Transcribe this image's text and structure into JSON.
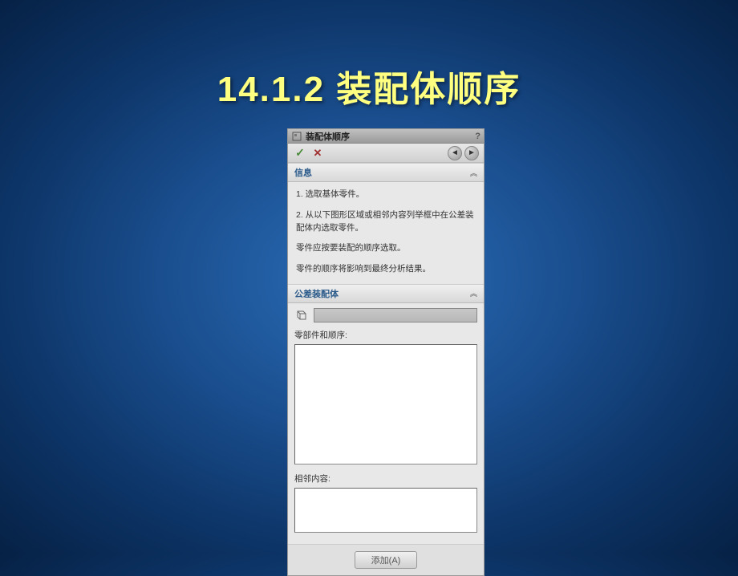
{
  "slide": {
    "title": "14.1.2  装配体顺序"
  },
  "panel": {
    "title": "装配体顺序",
    "help": "?",
    "sections": {
      "info": {
        "header": "信息",
        "line1": "1. 选取基体零件。",
        "line2": "2. 从以下图形区域或相邻内容列举框中在公差装配体内选取零件。",
        "line3": "零件应按要装配的顺序选取。",
        "line4": "零件的顺序将影响到最终分析结果。"
      },
      "tolerance": {
        "header": "公差装配体",
        "input_value": "",
        "parts_label": "零部件和顺序:",
        "adjacent_label": "相邻内容:"
      }
    },
    "buttons": {
      "add": "添加(A)"
    }
  }
}
